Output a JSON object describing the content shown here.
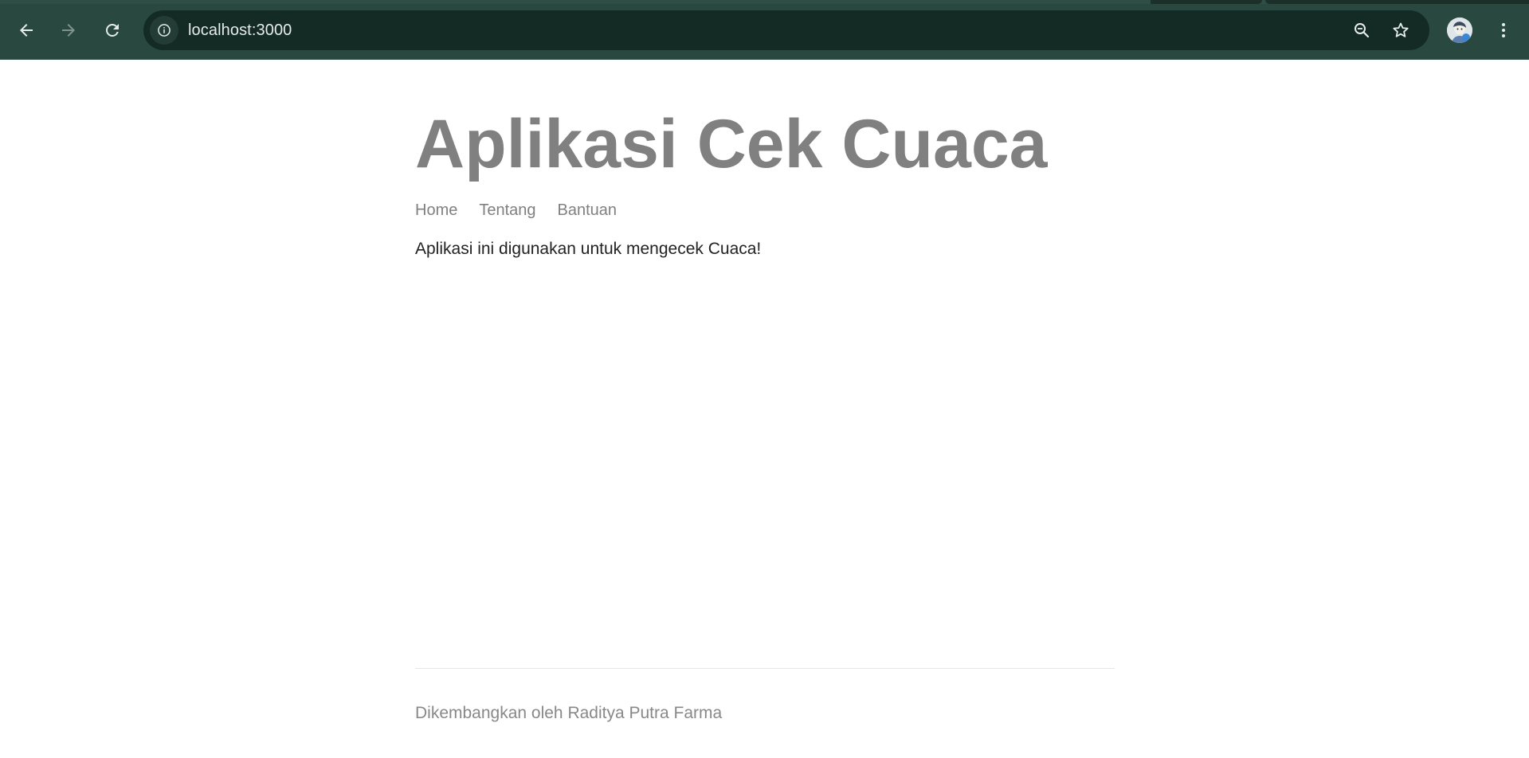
{
  "browser": {
    "url": "localhost:3000",
    "colors": {
      "toolbar": "#294840",
      "omnibox": "#142a25",
      "icon": "#e6ece9",
      "icon_disabled": "#7f928d"
    },
    "icons": [
      "back-arrow-icon",
      "forward-arrow-icon",
      "reload-icon",
      "site-info-icon",
      "zoom-out-icon",
      "bookmark-star-icon",
      "profile-avatar",
      "more-vert-icon"
    ]
  },
  "page": {
    "title": "Aplikasi Cek Cuaca",
    "nav": [
      {
        "label": "Home"
      },
      {
        "label": "Tentang"
      },
      {
        "label": "Bantuan"
      }
    ],
    "intro": "Aplikasi ini digunakan untuk mengecek Cuaca!",
    "footer": "Dikembangkan oleh Raditya Putra Farma",
    "colors": {
      "title": "#808080",
      "nav": "#808080",
      "body_text": "#222222",
      "footer_text": "#888888",
      "divider": "#e6e6e6"
    }
  }
}
